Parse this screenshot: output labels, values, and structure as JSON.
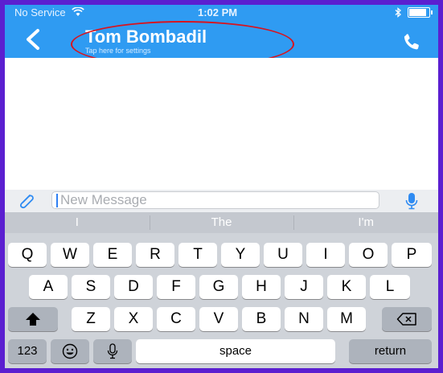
{
  "status_bar": {
    "carrier": "No Service",
    "time": "1:02 PM"
  },
  "header": {
    "title": "Tom Bombadil",
    "subtitle": "Tap here for settings"
  },
  "composer": {
    "placeholder": "New Message"
  },
  "suggestions": [
    "I",
    "The",
    "I'm"
  ],
  "keyboard": {
    "row1": [
      "Q",
      "W",
      "E",
      "R",
      "T",
      "Y",
      "U",
      "I",
      "O",
      "P"
    ],
    "row2": [
      "A",
      "S",
      "D",
      "F",
      "G",
      "H",
      "J",
      "K",
      "L"
    ],
    "row3": [
      "Z",
      "X",
      "C",
      "V",
      "B",
      "N",
      "M"
    ],
    "numbers_label": "123",
    "space_label": "space",
    "return_label": "return"
  },
  "colors": {
    "header": "#2f9bf2",
    "annotation_border": "#5b1fd0",
    "annotation_ellipse": "#d8141e"
  },
  "icons": [
    "wifi-icon",
    "bluetooth-icon",
    "battery-icon",
    "back-chevron-icon",
    "phone-icon",
    "paperclip-icon",
    "microphone-icon",
    "shift-icon",
    "backspace-icon",
    "emoji-icon",
    "dictation-icon"
  ]
}
